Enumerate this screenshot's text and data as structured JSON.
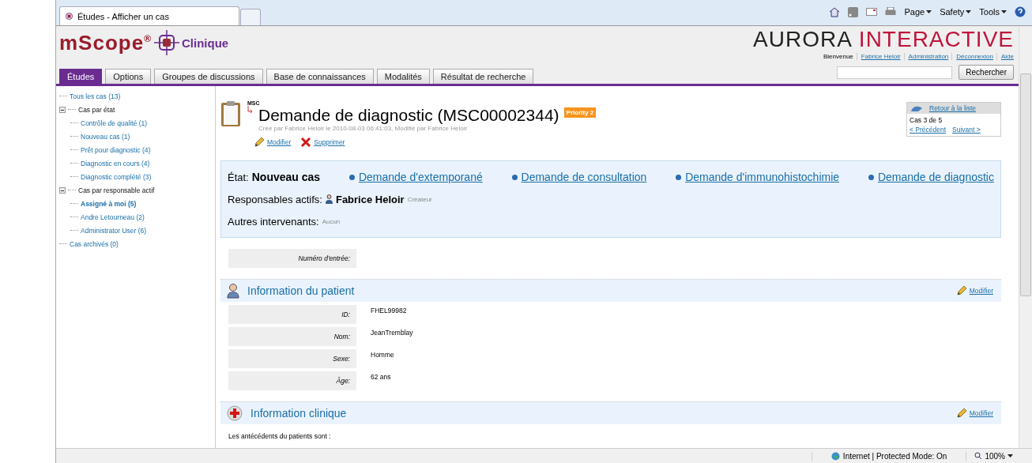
{
  "browser": {
    "tab_title": "Études - Afficher un cas",
    "menus": [
      "Page",
      "Safety",
      "Tools"
    ]
  },
  "header": {
    "product": "mScope$^{®}$",
    "product_suffix": "Clinique",
    "brand_dark": "AURORA",
    "brand_red": "INTERACTIVE",
    "welcome": "Bienvenue",
    "user_links": [
      "Fabrice Heloir",
      "Administration",
      "Déconnexion",
      "Aide"
    ],
    "search_button": "Rechercher"
  },
  "tabs": [
    {
      "label": "Études",
      "selected": true
    },
    {
      "label": "Options",
      "selected": false
    },
    {
      "label": "Groupes de discussions",
      "selected": false
    },
    {
      "label": "Base de connaissances",
      "selected": false
    },
    {
      "label": "Modalités",
      "selected": false
    },
    {
      "label": "Résultat de recherche",
      "selected": false
    }
  ],
  "sidebar": {
    "items": [
      {
        "label": "Tous les cas (13)",
        "selected": false
      },
      {
        "label": "Cas par état",
        "expanded": true,
        "children": [
          {
            "label": "Contrôle de qualité (1)",
            "selected": false
          },
          {
            "label": "Nouveau cas (1)",
            "selected": false
          },
          {
            "label": "Prêt pour diagnostic (4)",
            "selected": false
          },
          {
            "label": "Diagnostic en cours (4)",
            "selected": false
          },
          {
            "label": "Diagnostic complété (3)",
            "selected": false
          }
        ]
      },
      {
        "label": "Cas par responsable actif",
        "expanded": true,
        "children": [
          {
            "label": "Assigné à moi (5)",
            "selected": true
          },
          {
            "label": "Andre Letourneau (2)",
            "selected": false
          },
          {
            "label": "Administrator User (6)",
            "selected": false
          }
        ]
      },
      {
        "label": "Cas archivés (0)",
        "selected": false
      }
    ]
  },
  "case": {
    "category": "MSC",
    "title": "Demande de diagnostic (MSC00002344)",
    "priority": "Priority 2",
    "meta": "Créé par Fabrice Heloir le 2010-08-03 06:41:03, Modifié par Fabrice Heloir",
    "actions": [
      {
        "label": "Modifier",
        "kind": "edit"
      },
      {
        "label": "Supprimer",
        "kind": "delete"
      }
    ],
    "navigator": {
      "back": "Retour à la liste",
      "position": "Cas 3 de 5",
      "previous": "< Précédent",
      "next": "Suivant >"
    }
  },
  "status_panel": {
    "state_label": "État:",
    "state": "Nouveau cas",
    "requests": [
      "Demande d'extemporané",
      "Demande de consultation",
      "Demande d'immunohistochimie",
      "Demande de diagnostic"
    ],
    "responsible_label": "Responsables actifs:",
    "responsible": "Fabrice Heloir",
    "role": "Créateur",
    "others_label": "Autres intervenants:",
    "others": "Aucun"
  },
  "entry_fields": [
    {
      "label": "Numéro d'entrée:"
    }
  ],
  "sections": [
    {
      "kind": "patient",
      "title": "Information du patient",
      "edit": "Modifier",
      "fields": [
        {
          "label": "ID:",
          "value": "FHEL99982"
        },
        {
          "label": "Nom:",
          "value": "JeanTremblay"
        },
        {
          "label": "Sexe:",
          "value": "Homme"
        },
        {
          "label": "Âge:",
          "value": "62 ans"
        }
      ]
    },
    {
      "kind": "clinical",
      "title": "Information clinique",
      "edit": "Modifier",
      "text": "Les antécédents du patients sont :"
    }
  ],
  "status_bar": {
    "zone": "Internet | Protected Mode: On",
    "zoom": "100%"
  }
}
